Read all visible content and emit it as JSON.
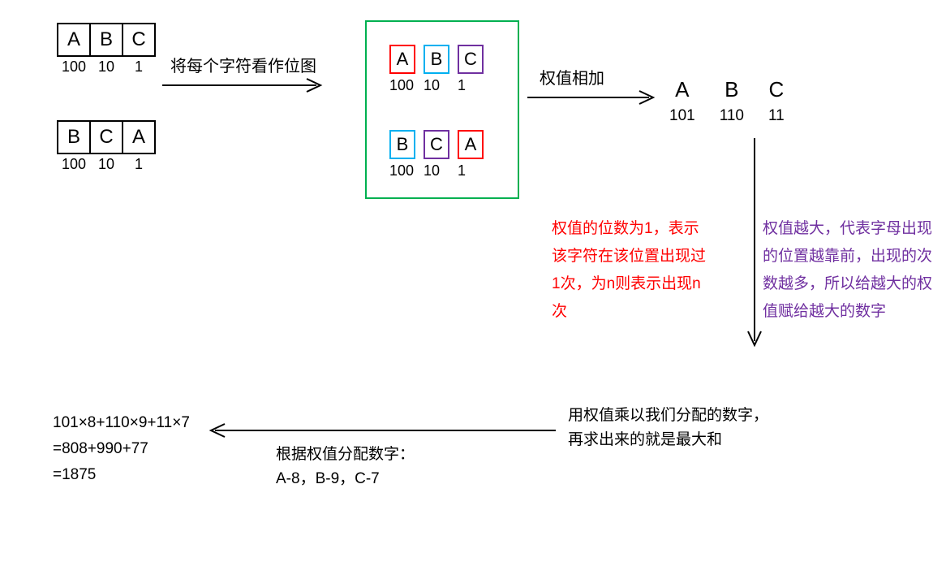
{
  "input1": {
    "cells": [
      "A",
      "B",
      "C"
    ],
    "vals": [
      "100",
      "10",
      "1"
    ]
  },
  "input2": {
    "cells": [
      "B",
      "C",
      "A"
    ],
    "vals": [
      "100",
      "10",
      "1"
    ]
  },
  "label1": "将每个字符看作位图",
  "mid1": {
    "cells": [
      "A",
      "B",
      "C"
    ],
    "vals": [
      "100",
      "10",
      "1"
    ]
  },
  "mid2": {
    "cells": [
      "B",
      "C",
      "A"
    ],
    "vals": [
      "100",
      "10",
      "1"
    ]
  },
  "label2": "权值相加",
  "result": [
    {
      "letter": "A",
      "num": "101"
    },
    {
      "letter": "B",
      "num": "110"
    },
    {
      "letter": "C",
      "num": "11"
    }
  ],
  "red_note": "权值的位数为1，表示该字符在该位置出现过1次，为n则表示出现n次",
  "purple_note": "权值越大，代表字母出现的位置越靠前，出现的次数越多，所以给越大的权值赋给越大的数字",
  "bottom_right": "用权值乘以我们分配的数字，再求出来的就是最大和",
  "assign_label": "根据权值分配数字：",
  "assign_values": "A-8，B-9，C-7",
  "calc1": "101×8+110×9+11×7",
  "calc2": "=808+990+77",
  "calc3": "=1875"
}
